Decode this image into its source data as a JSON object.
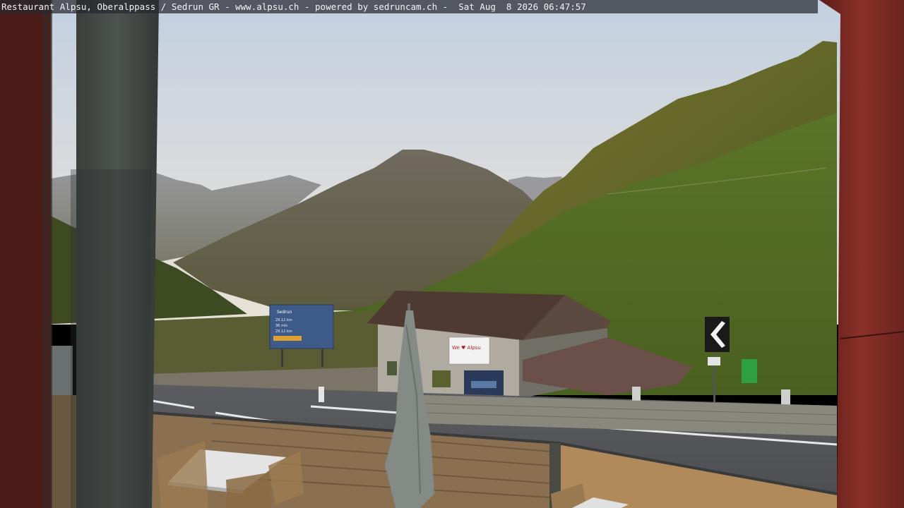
{
  "overlay": {
    "caption": "Restaurant Alpsu, Oberalppass / Sedrun GR - www.alpsu.ch - powered by sedruncam.ch -  Sat Aug  8 2026 06:47:57"
  },
  "scene": {
    "hut_sign": "We ♥ Alpsu",
    "billboard_brand": "Sedrun",
    "billboard_lines": [
      "29.12 km",
      "36 min",
      "29.12 km"
    ],
    "colors": {
      "sky_top": "#c4d2e2",
      "sky_bottom": "#e6e2d8",
      "slope_green": "#4f6a22",
      "sunlit_ridge": "#b07a30",
      "frame_red": "#7a2a24"
    }
  }
}
